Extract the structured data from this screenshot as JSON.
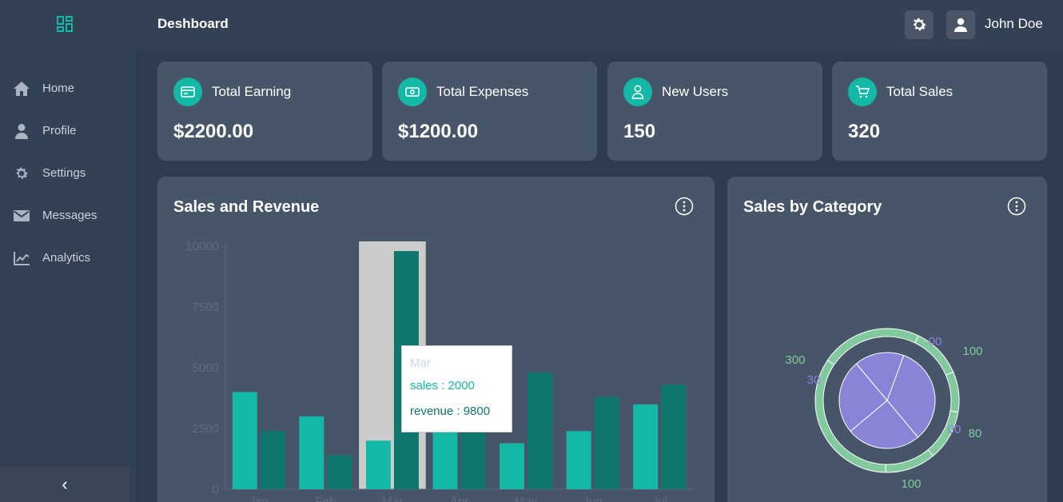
{
  "header": {
    "title": "Deshboard",
    "user_name": "John Doe"
  },
  "sidebar": {
    "items": [
      {
        "label": "Home",
        "icon": "home-icon"
      },
      {
        "label": "Profile",
        "icon": "user-icon"
      },
      {
        "label": "Settings",
        "icon": "gear-icon"
      },
      {
        "label": "Messages",
        "icon": "envelope-icon"
      },
      {
        "label": "Analytics",
        "icon": "chart-line-icon"
      }
    ],
    "collapse_glyph": "‹"
  },
  "cards": [
    {
      "title": "Total Earning",
      "value": "$2200.00",
      "icon": "credit-card-icon"
    },
    {
      "title": "Total Expenses",
      "value": "$1200.00",
      "icon": "cash-icon"
    },
    {
      "title": "New Users",
      "value": "150",
      "icon": "user-icon"
    },
    {
      "title": "Total Sales",
      "value": "320",
      "icon": "cart-icon"
    }
  ],
  "sales_panel": {
    "title": "Sales and Revenue"
  },
  "category_panel": {
    "title": "Sales by Category"
  },
  "colors": {
    "accent": "#14b8a6",
    "accent_dark": "#0f766e",
    "purple": "#8884d8",
    "green": "#82ca9d"
  },
  "chart_data": [
    {
      "type": "bar",
      "categories": [
        "Jan",
        "Feb",
        "Mar",
        "Apr",
        "May",
        "Jun",
        "Jul"
      ],
      "series": [
        {
          "name": "sales",
          "values": [
            4000,
            3000,
            2000,
            2780,
            1890,
            2390,
            3490
          ]
        },
        {
          "name": "revenue",
          "values": [
            2400,
            1398,
            9800,
            3908,
            4800,
            3800,
            4300
          ]
        }
      ],
      "yticks": [
        "0",
        "2500",
        "5000",
        "7500",
        "10000"
      ],
      "ylim": [
        0,
        10000
      ],
      "tooltip": {
        "category": "Mar",
        "sales_text": "sales : 2000",
        "revenue_text": "revenue : 9800"
      }
    },
    {
      "type": "pie",
      "inner_values": [
        400,
        300,
        300,
        200
      ],
      "outer_values": [
        100,
        80,
        100,
        100,
        300,
        200
      ],
      "labels": [
        {
          "text": "00",
          "series": "inner"
        },
        {
          "text": "100",
          "series": "outer"
        },
        {
          "text": "300",
          "series": "outer"
        },
        {
          "text": "30",
          "series": "inner"
        },
        {
          "text": "00",
          "series": "inner"
        },
        {
          "text": "80",
          "series": "outer"
        },
        {
          "text": "100",
          "series": "outer"
        }
      ]
    }
  ]
}
